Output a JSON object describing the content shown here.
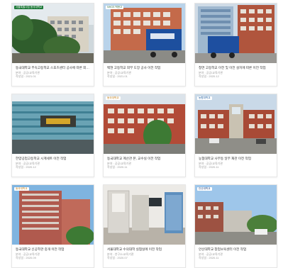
{
  "cards": [
    {
      "title": "동국대학교 부속고등학교 스포츠센터 공사에 따른 외관 …",
      "category": "분야 : 공공/교육기관",
      "date": "작성일 : 2021.01",
      "badge": "서울특별시립 동국대학교",
      "badge_bg": "#1f7a3a",
      "badge_fg": "#ffffff"
    },
    {
      "title": "백현 고등학교 외부 도장 공사 이전 작업",
      "category": "분야 : 공공/교육기관",
      "date": "작성일 : 2021.01",
      "badge": "NHGS 백현고",
      "badge_bg": "#ffffff",
      "badge_fg": "#2a6b3a"
    },
    {
      "title": "청연 고등학교 이전 및 이전 설치에 따른 이전 작업",
      "category": "분야 : 공공/교육기관",
      "date": "작성일 : 2020.12",
      "badge": "",
      "badge_bg": "",
      "badge_fg": ""
    },
    {
      "title": "한양공업고등학교 시계세트 이전 작업",
      "category": "분야 : 공공/교육기관",
      "date": "작성일 : 2020.12",
      "badge": "",
      "badge_bg": "",
      "badge_fg": ""
    },
    {
      "title": "동국대학교 계산관 본, 교수실 이전 작업",
      "category": "분야 : 공공/교육기관",
      "date": "작성일 : 2020.11",
      "badge": "동국대학교",
      "badge_bg": "#ffffff",
      "badge_fg": "#c07a10"
    },
    {
      "title": "농협대학교 사무동 일부 재관 이전 작업",
      "category": "분야 : 공공/교육기관",
      "date": "작성일 : 2020.11",
      "badge": "농협대학교",
      "badge_bg": "#ffffff",
      "badge_fg": "#1e5c9e"
    },
    {
      "title": "동국대학교 신공학관 중개 이전 작업",
      "category": "분야 : 공공/교육기관",
      "date": "작성일 : 2020.09",
      "badge": "동국대학교",
      "badge_bg": "#ffffff",
      "badge_fg": "#c07a10"
    },
    {
      "title": "서울대학교 수의대학 실험실에 이전 작업",
      "category": "분야 : 연구소/교육기관",
      "date": "작성일 : 2020.07",
      "badge": "",
      "badge_bg": "",
      "badge_fg": ""
    },
    {
      "title": "안산대학교 창업보육센터 이전 작업",
      "category": "분야 : 공공/교육기관",
      "date": "작성일 : 2020.11",
      "badge": "안산대학교",
      "badge_bg": "#ffffff",
      "badge_fg": "#1e3f7a"
    }
  ]
}
